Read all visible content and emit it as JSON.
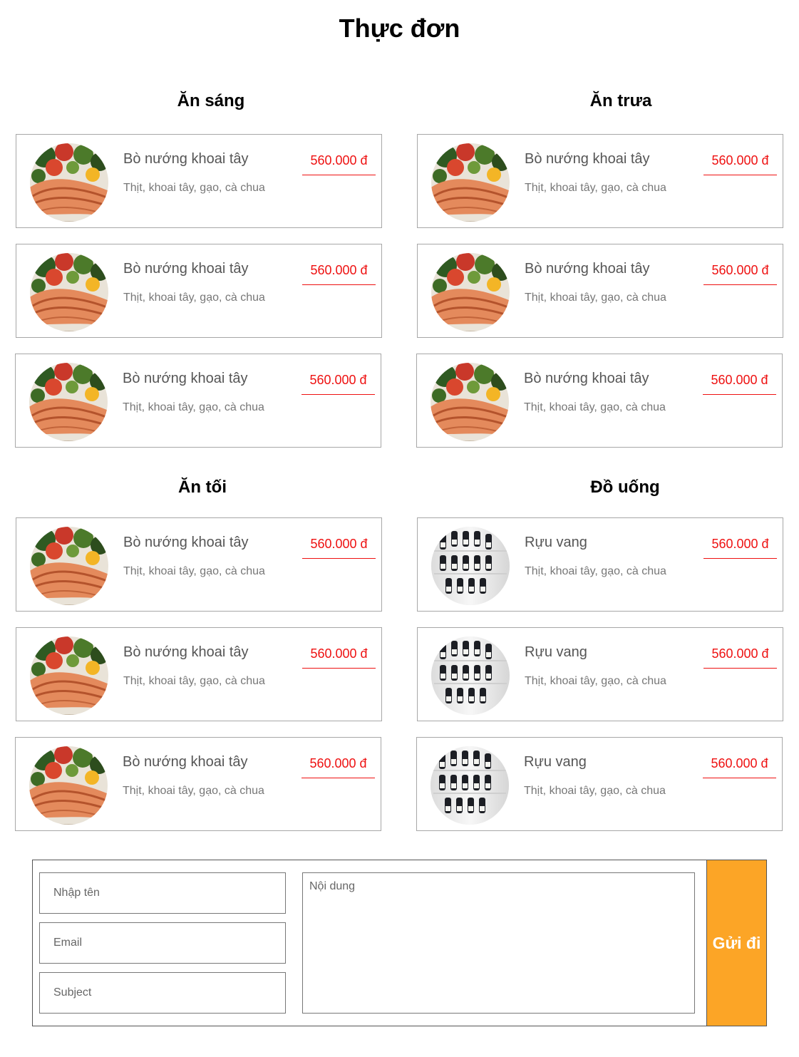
{
  "page": {
    "title": "Thực đơn"
  },
  "colors": {
    "price": "#ee1111",
    "send_button": "#fca526",
    "card_border": "#a7a7a7"
  },
  "menu": {
    "breakfast": {
      "title": "Ăn sáng",
      "items": [
        {
          "name": "Bò nướng khoai tây",
          "desc": "Thịt, khoai tây, gạo, cà chua",
          "price": "560.000 đ",
          "image": "grilled-salmon-photo"
        },
        {
          "name": "Bò nướng khoai tây",
          "desc": "Thịt, khoai tây, gạo, cà chua",
          "price": "560.000 đ",
          "image": "grilled-salmon-photo"
        },
        {
          "name": "Bò nướng khoai tây",
          "desc": "Thịt, khoai tây, gạo, cà chua",
          "price": "560.000 đ",
          "image": "grilled-salmon-photo"
        }
      ]
    },
    "lunch": {
      "title": "Ăn trưa",
      "items": [
        {
          "name": "Bò nướng khoai tây",
          "desc": "Thịt, khoai tây, gạo, cà chua",
          "price": "560.000 đ",
          "image": "grilled-salmon-photo"
        },
        {
          "name": "Bò nướng khoai tây",
          "desc": "Thịt, khoai tây, gạo, cà chua",
          "price": "560.000 đ",
          "image": "grilled-salmon-photo"
        },
        {
          "name": "Bò nướng khoai tây",
          "desc": "Thịt, khoai tây, gạo, cà chua",
          "price": "560.000 đ",
          "image": "grilled-salmon-photo"
        }
      ]
    },
    "dinner": {
      "title": "Ăn tối",
      "items": [
        {
          "name": "Bò nướng khoai tây",
          "desc": "Thịt, khoai tây, gạo, cà chua",
          "price": "560.000 đ",
          "image": "grilled-salmon-photo"
        },
        {
          "name": "Bò nướng khoai tây",
          "desc": "Thịt, khoai tây, gạo, cà chua",
          "price": "560.000 đ",
          "image": "grilled-salmon-photo"
        },
        {
          "name": "Bò nướng khoai tây",
          "desc": "Thịt, khoai tây, gạo, cà chua",
          "price": "560.000 đ",
          "image": "grilled-salmon-photo"
        }
      ]
    },
    "drinks": {
      "title": "Đồ uống",
      "items": [
        {
          "name": "Rựu vang",
          "desc": "Thịt, khoai tây, gạo, cà chua",
          "price": "560.000 đ",
          "image": "wine-bottles-photo"
        },
        {
          "name": "Rựu vang",
          "desc": "Thịt, khoai tây, gạo, cà chua",
          "price": "560.000 đ",
          "image": "wine-bottles-photo"
        },
        {
          "name": "Rựu vang",
          "desc": "Thịt, khoai tây, gạo, cà chua",
          "price": "560.000 đ",
          "image": "wine-bottles-photo"
        }
      ]
    }
  },
  "form": {
    "name_placeholder": "Nhập tên",
    "email_placeholder": "Email",
    "subject_placeholder": "Subject",
    "message_placeholder": "Nội dung",
    "name_value": "",
    "email_value": "",
    "subject_value": "",
    "message_value": "",
    "submit_label": "Gửi đi"
  }
}
